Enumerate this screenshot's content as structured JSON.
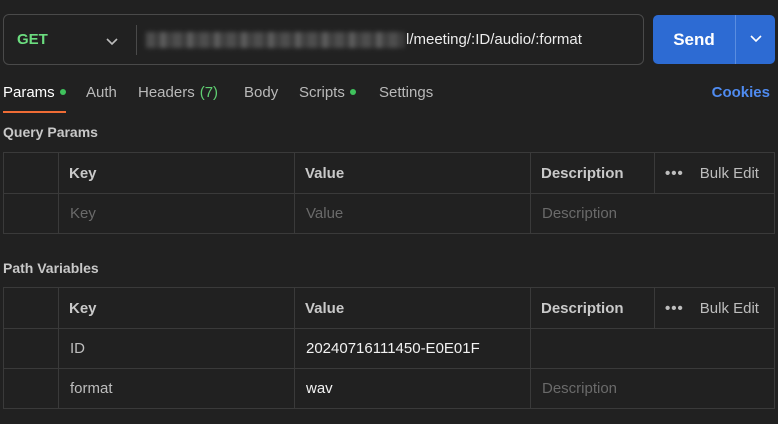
{
  "request": {
    "method": "GET",
    "url_visible": "l/meeting/:ID/audio/:format",
    "send_label": "Send"
  },
  "tabs": [
    {
      "label": "Params",
      "has_dot": true
    },
    {
      "label": "Auth"
    },
    {
      "label": "Headers",
      "count": "(7)"
    },
    {
      "label": "Body"
    },
    {
      "label": "Scripts",
      "has_dot": true
    },
    {
      "label": "Settings"
    }
  ],
  "cookies_label": "Cookies",
  "query_params": {
    "title": "Query Params",
    "headers": {
      "key": "Key",
      "value": "Value",
      "description": "Description",
      "bulk_edit": "Bulk Edit"
    },
    "placeholder": {
      "key": "Key",
      "value": "Value",
      "description": "Description"
    }
  },
  "path_variables": {
    "title": "Path Variables",
    "headers": {
      "key": "Key",
      "value": "Value",
      "description": "Description",
      "bulk_edit": "Bulk Edit"
    },
    "rows": [
      {
        "key": "ID",
        "value": "20240716111450-E0E01F",
        "description": ""
      },
      {
        "key": "format",
        "value": "wav",
        "description_placeholder": "Description"
      }
    ]
  },
  "colors": {
    "method_get": "#6bdd7f",
    "send_button": "#2d6bd3",
    "active_tab_underline": "#ef6c35",
    "status_dot": "#3fc25c",
    "cookies_link": "#4f8bf0"
  }
}
